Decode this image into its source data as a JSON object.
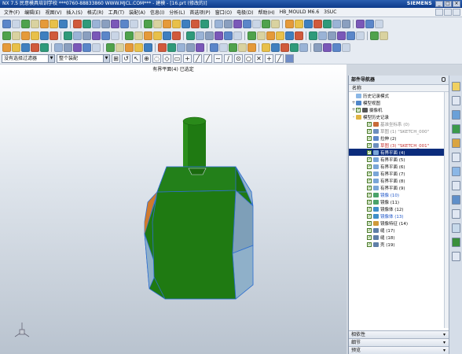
{
  "titlebar": {
    "title": "NX 7.5 民意模具培训学校  ***0760-88833860  WWW.MJCL.COM***  - 建模 - [16.prt (修改的)]",
    "brand": "SIEMENS",
    "controls": [
      "_",
      "□",
      "×"
    ]
  },
  "menu": {
    "items": [
      "文件(F)",
      "编辑(E)",
      "视图(V)",
      "插入(S)",
      "格式(R)",
      "工具(T)",
      "装配(A)",
      "信息(I)",
      "分析(L)",
      "首选项(P)",
      "窗口(O)",
      "电极(D)",
      "帮助(H)",
      "HB_MOULD M6.6",
      "3SUC"
    ]
  },
  "selection_bar": {
    "filter_value": "没有选择过滤器",
    "scope_value": "整个装配"
  },
  "viewport": {
    "status_cue": "有界平面(4) 已选定",
    "colors": {
      "body": "#1f7a12",
      "facets": "#8fb0c9",
      "accent": "#d07a2e",
      "edge": "#2f6fd0"
    }
  },
  "navigator": {
    "title": "部件导航器",
    "column": "名称",
    "rows": [
      {
        "indent": 0,
        "exp": "",
        "check": false,
        "icon": "history-icon",
        "label": "历史记录模式",
        "style": ""
      },
      {
        "indent": 0,
        "exp": "+",
        "check": false,
        "icon": "model-views-icon",
        "label": "模型视图",
        "style": ""
      },
      {
        "indent": 0,
        "exp": "+",
        "check": true,
        "icon": "camera-icon",
        "label": "摄像机",
        "style": ""
      },
      {
        "indent": 0,
        "exp": "-",
        "check": false,
        "icon": "model-history-icon",
        "label": "模型历史记录",
        "style": ""
      },
      {
        "indent": 1,
        "exp": "",
        "check": true,
        "icon": "datum-csys-icon",
        "label": "基准坐标系 (0)",
        "style": "grey"
      },
      {
        "indent": 1,
        "exp": "",
        "check": true,
        "icon": "sketch-icon",
        "label": "草图 (1) \"SKETCH_000\"",
        "style": "grey"
      },
      {
        "indent": 1,
        "exp": "",
        "check": true,
        "icon": "extrude-icon",
        "label": "拉伸 (2)",
        "style": ""
      },
      {
        "indent": 1,
        "exp": "",
        "check": true,
        "icon": "sketch-icon",
        "label": "草图 (3) \"SKETCH_001\"",
        "style": "red"
      },
      {
        "indent": 1,
        "exp": "",
        "check": true,
        "icon": "bounded-plane-icon",
        "label": "有界平面 (4)",
        "style": "sel"
      },
      {
        "indent": 1,
        "exp": "",
        "check": true,
        "icon": "bounded-plane-icon",
        "label": "有界平面 (5)",
        "style": ""
      },
      {
        "indent": 1,
        "exp": "",
        "check": true,
        "icon": "bounded-plane-icon",
        "label": "有界平面 (6)",
        "style": ""
      },
      {
        "indent": 1,
        "exp": "",
        "check": true,
        "icon": "bounded-plane-icon",
        "label": "有界平面 (7)",
        "style": ""
      },
      {
        "indent": 1,
        "exp": "",
        "check": true,
        "icon": "bounded-plane-icon",
        "label": "有界平面 (8)",
        "style": ""
      },
      {
        "indent": 1,
        "exp": "",
        "check": true,
        "icon": "bounded-plane-icon",
        "label": "有界平面 (9)",
        "style": ""
      },
      {
        "indent": 1,
        "exp": "",
        "check": true,
        "icon": "mirror-icon",
        "label": "镜像 (10)",
        "style": "blue"
      },
      {
        "indent": 1,
        "exp": "",
        "check": true,
        "icon": "mirror-icon",
        "label": "镜像 (11)",
        "style": ""
      },
      {
        "indent": 1,
        "exp": "",
        "check": true,
        "icon": "mirror-body-icon",
        "label": "镜像体 (12)",
        "style": ""
      },
      {
        "indent": 1,
        "exp": "",
        "check": true,
        "icon": "mirror-body-icon",
        "label": "镜像体 (13)",
        "style": "blue"
      },
      {
        "indent": 1,
        "exp": "",
        "check": true,
        "icon": "mirror-feature-icon",
        "label": "镜像特征 (14)",
        "style": ""
      },
      {
        "indent": 1,
        "exp": "",
        "check": true,
        "icon": "sew-icon",
        "label": "缝 (17)",
        "style": ""
      },
      {
        "indent": 1,
        "exp": "",
        "check": true,
        "icon": "sew-icon",
        "label": "缝 (18)",
        "style": ""
      },
      {
        "indent": 1,
        "exp": "",
        "check": true,
        "icon": "sew-icon",
        "label": "壳 (19)",
        "style": ""
      }
    ],
    "panels": [
      "相依性",
      "细节",
      "预览"
    ]
  }
}
